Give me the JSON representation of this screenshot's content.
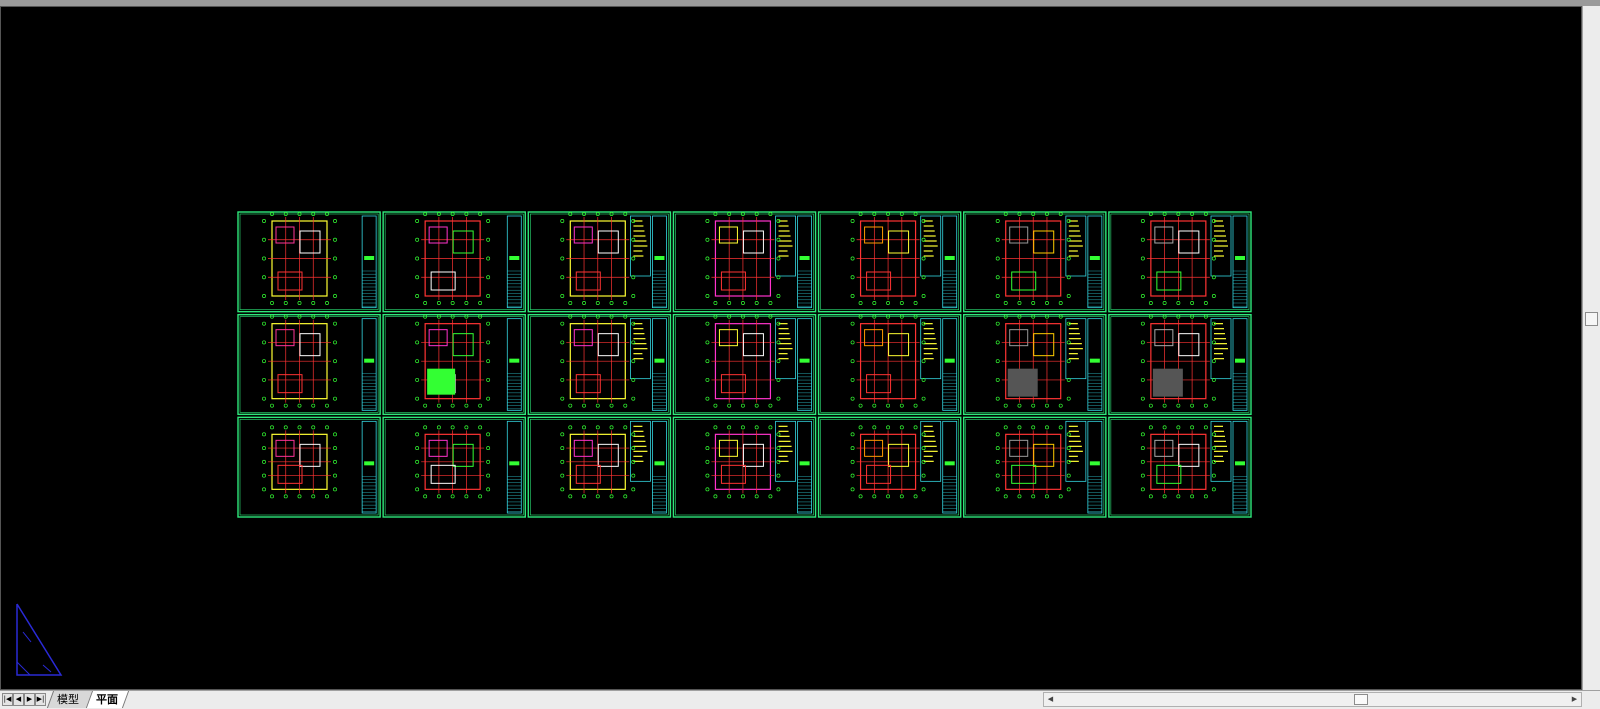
{
  "layout_tabs": [
    {
      "label": "模型",
      "active": false
    },
    {
      "label": "平面",
      "active": true
    }
  ],
  "nav_buttons": [
    {
      "glyph": "|◀"
    },
    {
      "glyph": "◀"
    },
    {
      "glyph": "▶"
    },
    {
      "glyph": "▶|"
    }
  ],
  "scroll_glyphs": {
    "left": "◀",
    "right": "▶"
  },
  "drawing": {
    "rows": 3,
    "cols": 7,
    "sheet_border_color": "#2ee87a",
    "title_block_color": "#34d6e0",
    "ucs_icon": "ucs-triangle-icon",
    "ucs_color": "#2a2ad6"
  }
}
